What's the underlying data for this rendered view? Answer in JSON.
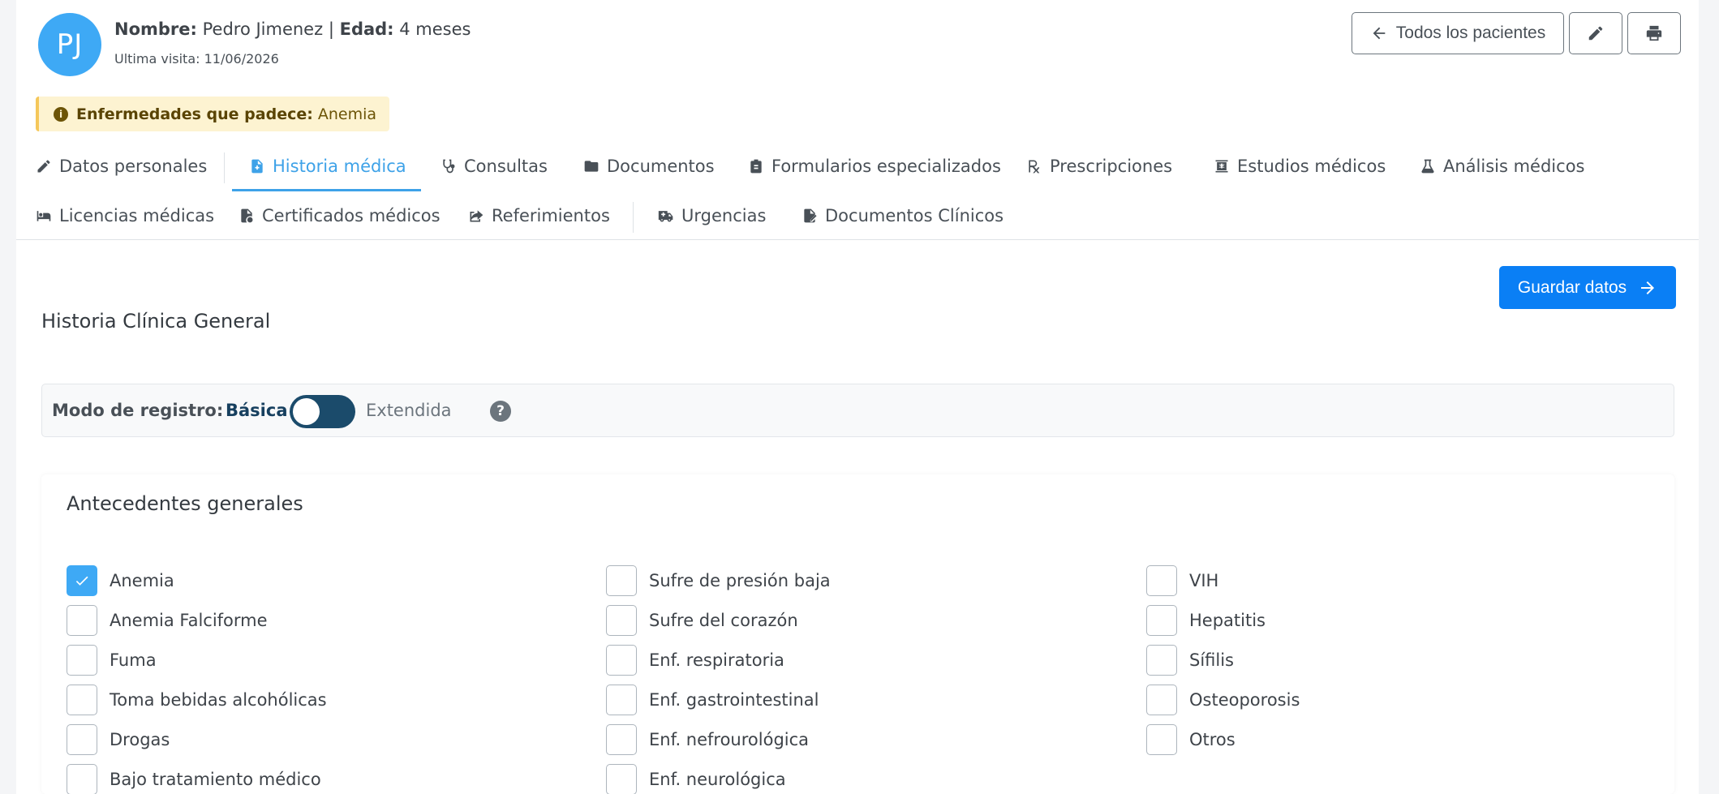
{
  "header": {
    "avatar_initials": "PJ",
    "name_label": "Nombre:",
    "name_value": "Pedro Jimenez",
    "separator": "|",
    "age_label": "Edad:",
    "age_value": "4 meses",
    "last_visit": "Ultima visita: 11/06/2026",
    "all_patients_label": "Todos los pacientes",
    "edit_icon": "pencil-icon",
    "print_icon": "printer-icon"
  },
  "alert": {
    "label": "Enfermedades que padece:",
    "value": "Anemia",
    "icon": "info-circle-icon"
  },
  "tabs": [
    {
      "label": "Datos personales",
      "icon": "pencil-icon",
      "active": false
    },
    {
      "label": "Historia médica",
      "icon": "file-medical-icon",
      "active": true
    },
    {
      "label": "Consultas",
      "icon": "stethoscope-icon",
      "active": false
    },
    {
      "label": "Documentos",
      "icon": "folder-icon",
      "active": false
    },
    {
      "label": "Formularios especializados",
      "icon": "clipboard-icon",
      "active": false
    },
    {
      "label": "Prescripciones",
      "icon": "prescription-icon",
      "active": false
    },
    {
      "label": "Estudios médicos",
      "icon": "x-ray-icon",
      "active": false
    },
    {
      "label": "Análisis médicos",
      "icon": "flask-icon",
      "active": false
    },
    {
      "label": "Licencias médicas",
      "icon": "bed-icon",
      "active": false
    },
    {
      "label": "Certificados médicos",
      "icon": "file-certificate-icon",
      "active": false
    },
    {
      "label": "Referimientos",
      "icon": "share-icon",
      "active": false
    },
    {
      "label": "Urgencias",
      "icon": "ambulance-icon",
      "active": false
    },
    {
      "label": "Documentos Clínicos",
      "icon": "file-signature-icon",
      "active": false
    }
  ],
  "main": {
    "save_label": "Guardar datos",
    "section_title": "Historia Clínica General",
    "mode_label": "Modo de registro:",
    "mode_basic": "Básica",
    "mode_extended": "Extendida",
    "mode_extended_on": false,
    "help_symbol": "?"
  },
  "antecedentes": {
    "title": "Antecedentes generales",
    "items": [
      {
        "label": "Anemia",
        "checked": true
      },
      {
        "label": "Anemia Falciforme",
        "checked": false
      },
      {
        "label": "Fuma",
        "checked": false
      },
      {
        "label": "Toma bebidas alcohólicas",
        "checked": false
      },
      {
        "label": "Drogas",
        "checked": false
      },
      {
        "label": "Bajo tratamiento médico",
        "checked": false
      },
      {
        "label": "Sufre de presión baja",
        "checked": false
      },
      {
        "label": "Sufre del corazón",
        "checked": false
      },
      {
        "label": "Enf. respiratoria",
        "checked": false
      },
      {
        "label": "Enf. gastrointestinal",
        "checked": false
      },
      {
        "label": "Enf. nefrourológica",
        "checked": false
      },
      {
        "label": "Enf. neurológica",
        "checked": false
      },
      {
        "label": "VIH",
        "checked": false
      },
      {
        "label": "Hepatitis",
        "checked": false
      },
      {
        "label": "Sífilis",
        "checked": false
      },
      {
        "label": "Osteoporosis",
        "checked": false
      },
      {
        "label": "Otros",
        "checked": false
      }
    ]
  }
}
